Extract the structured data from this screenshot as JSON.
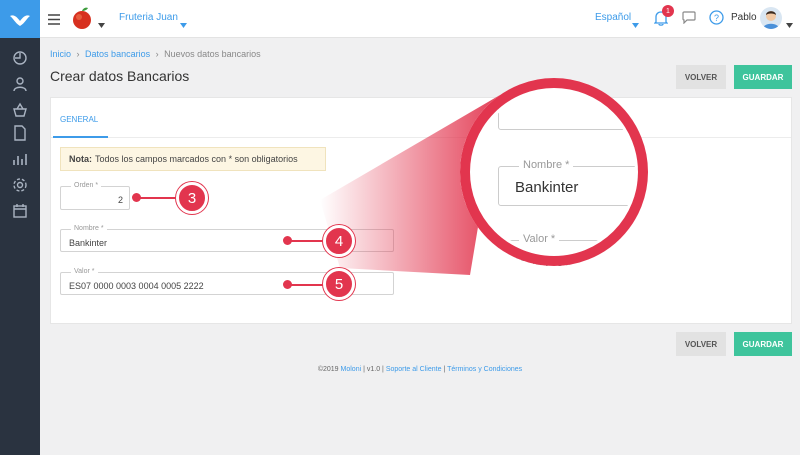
{
  "topbar": {
    "company": "Fruteria Juan",
    "language": "Español",
    "notification_count": "1",
    "user": "Pablo"
  },
  "breadcrumb": [
    "Inicio",
    "Datos bancarios",
    "Nuevos datos bancarios"
  ],
  "page": {
    "title": "Crear datos Bancarios",
    "back_label": "VOLVER",
    "save_label": "GUARDAR"
  },
  "tabs": [
    "GENERAL"
  ],
  "note": {
    "label": "Nota:",
    "text": "Todos los campos marcados con * son obligatorios"
  },
  "fields": {
    "order": {
      "label": "Orden *",
      "value": "2"
    },
    "name": {
      "label": "Nombre *",
      "value": "Bankinter"
    },
    "value": {
      "label": "Valor *",
      "value": "ES07 0000 0003 0004 0005 2222"
    }
  },
  "callouts": [
    "3",
    "4",
    "5"
  ],
  "zoom": {
    "label": "Nombre *",
    "value": "Bankinter",
    "next_label": "Valor *",
    "next_value_partial": "ES07 00"
  },
  "footer": {
    "copyright": "©2019",
    "brand": "Moloni",
    "version": "| v1.0 |",
    "support": "Soporte al Cliente",
    "sep": "|",
    "terms": "Términos y Condiciones"
  },
  "colors": {
    "accent": "#3d9be9",
    "save": "#3ec49c",
    "callout": "#e2354e",
    "sidebar": "#2a3340"
  }
}
